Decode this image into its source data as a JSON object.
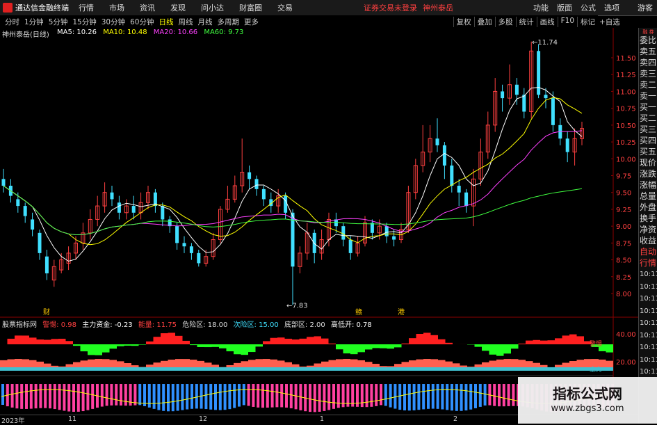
{
  "menubar": {
    "app_title": "通达信金融终端",
    "items": [
      "行情",
      "市场",
      "资讯",
      "发现",
      "问小达",
      "财富圈",
      "交易"
    ],
    "alert": "证券交易未登录",
    "stock_link": "神州泰岳",
    "right_items": [
      "功能",
      "版面",
      "公式",
      "选项"
    ],
    "guest": "游客"
  },
  "toolbar": {
    "periods": [
      "分时",
      "1分钟",
      "5分钟",
      "15分钟",
      "30分钟",
      "60分钟",
      "日线",
      "周线",
      "月线",
      "多周期",
      "更多"
    ],
    "active_period": "日线",
    "right_buttons": [
      "复权",
      "叠加",
      "多股",
      "统计",
      "画线",
      "F10",
      "标记",
      "+自选"
    ]
  },
  "chart": {
    "stock_name": "神州泰岳(日线)",
    "ma": [
      {
        "label": "MA5: 10.26",
        "color": "#ffffff"
      },
      {
        "label": "MA10: 10.48",
        "color": "#ffff00"
      },
      {
        "label": "MA20: 10.66",
        "color": "#ff40ff"
      },
      {
        "label": "MA60: 9.73",
        "color": "#40ff40"
      }
    ],
    "high_marker": "11.74",
    "low_marker": "7.83",
    "y_ticks": [
      "11.50",
      "11.25",
      "11.00",
      "10.75",
      "10.50",
      "10.25",
      "10.00",
      "9.75",
      "9.50",
      "9.25",
      "9.00",
      "8.75",
      "8.50",
      "8.25",
      "8.00"
    ],
    "annotations": [
      "财",
      "赣",
      "港"
    ]
  },
  "sub": {
    "legend": [
      {
        "label": "股票指标网",
        "color": "#dddddd"
      },
      {
        "label": "警惕: 0.98",
        "color": "#ff4040"
      },
      {
        "label": "主力资金: -0.23",
        "color": "#ffffff"
      },
      {
        "label": "能量: 11.75",
        "color": "#ff4040"
      },
      {
        "label": "危险区: 18.00",
        "color": "#dddddd"
      },
      {
        "label": "次险区: 15.00",
        "color": "#40e0ff"
      },
      {
        "label": "底部区: 2.00",
        "color": "#dddddd"
      },
      {
        "label": "高低开: 0.78",
        "color": "#ffffff"
      }
    ],
    "y_ticks": [
      "40.00",
      "20.00"
    ],
    "series_labels": [
      "警惕",
      "主力"
    ]
  },
  "right_panel": {
    "header": "融 券",
    "items": [
      "委比",
      "卖五",
      "卖四",
      "卖三",
      "卖二",
      "卖一",
      "买一",
      "买二",
      "买三",
      "买四",
      "买五",
      "现价",
      "涨跌",
      "涨幅",
      "总量",
      "外盘",
      "换手",
      "净资",
      "收益"
    ],
    "special": [
      "自动",
      "行情"
    ],
    "times": [
      "10:11",
      "10:11",
      "10:11",
      "10:11",
      "10:11",
      "10:11",
      "10:11",
      "10:11",
      "10:11"
    ]
  },
  "date_axis": [
    "2023年",
    "11",
    "12",
    "1",
    "2"
  ],
  "watermark": {
    "title": "指标公式网",
    "url": "www.zbgs3.com"
  },
  "colors": {
    "up": "#ff4040",
    "down": "#40e0ff",
    "ma5": "#ffffff",
    "ma10": "#ffff00",
    "ma20": "#ff40ff",
    "ma60": "#40ff40"
  }
}
